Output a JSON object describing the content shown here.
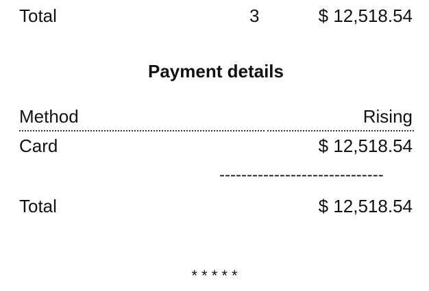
{
  "summary": {
    "total_label": "Total",
    "total_count": "3",
    "total_amount": "$ 12,518.54"
  },
  "payment": {
    "title": "Payment details",
    "headers": {
      "method": "Method",
      "amount": "Rising"
    },
    "rows": [
      {
        "method": "Card",
        "amount": "$ 12,518.54"
      }
    ],
    "separator": "------------------------------",
    "total_label": "Total",
    "total_amount": "$ 12,518.54"
  },
  "footer": {
    "stars": "* * * * *"
  }
}
